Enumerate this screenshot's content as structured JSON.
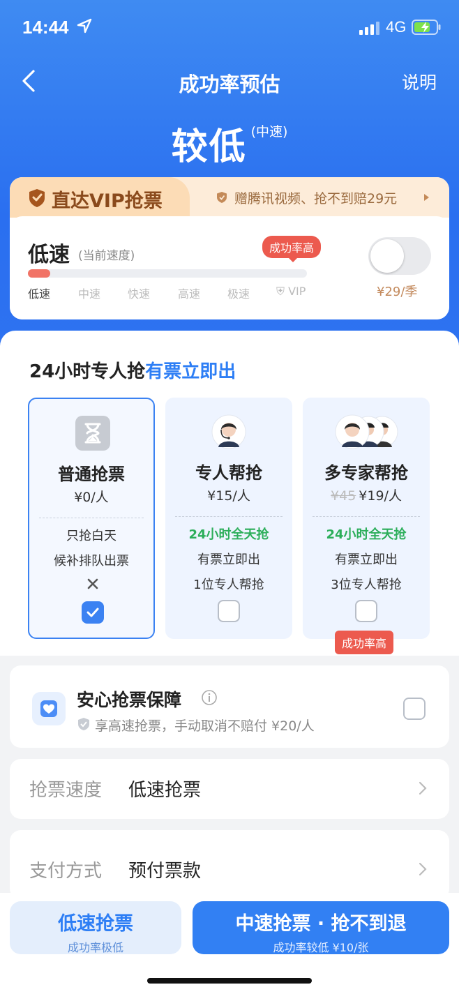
{
  "status_bar": {
    "time": "14:44",
    "network": "4G"
  },
  "nav": {
    "title": "成功率预估",
    "help": "说明"
  },
  "rate": {
    "level": "较低",
    "speed": "(中速)"
  },
  "vip": {
    "tab_label": "直达VIP抢票",
    "promo": "赠腾讯视频、抢不到赔29元",
    "speed_name": "低速",
    "speed_current": "(当前速度)",
    "bubble": "成功率高",
    "progress": 0.08,
    "ticks": [
      "低速",
      "中速",
      "快速",
      "高速",
      "极速",
      "VIP"
    ],
    "price": "¥29/季",
    "toggle_on": false
  },
  "options_section": {
    "title_prefix": "24小时专人抢",
    "title_highlight": "有票立即出",
    "options": [
      {
        "name": "普通抢票",
        "price": "¥0/人",
        "old_price": "",
        "f1": "只抢白天",
        "f2": "候补排队出票",
        "f3": "",
        "selected": true
      },
      {
        "name": "专人帮抢",
        "price": "¥15/人",
        "old_price": "",
        "f1": "24小时全天抢",
        "f2": "有票立即出",
        "f3": "1位专人帮抢",
        "selected": false
      },
      {
        "name": "多专家帮抢",
        "price": "¥19/人",
        "old_price": "¥45",
        "f1": "24小时全天抢",
        "f2": "有票立即出",
        "f3": "3位专人帮抢",
        "selected": false
      }
    ],
    "badge": "成功率高"
  },
  "safe": {
    "title": "安心抢票保障",
    "sub": "享高速抢票，手动取消不赔付  ¥20/人"
  },
  "rows": [
    {
      "key": "抢票速度",
      "value": "低速抢票"
    },
    {
      "key": "支付方式",
      "value": "预付票款"
    }
  ],
  "bottom": {
    "slow_title": "低速抢票",
    "slow_sub": "成功率极低",
    "mid_title": "中速抢票 · 抢不到退",
    "mid_sub": "成功率较低 ¥10/张"
  },
  "colors": {
    "brand_blue": "#2d7ef5",
    "green": "#2cae5a",
    "red": "#ec5a4e",
    "gold": "#c38a5d"
  }
}
